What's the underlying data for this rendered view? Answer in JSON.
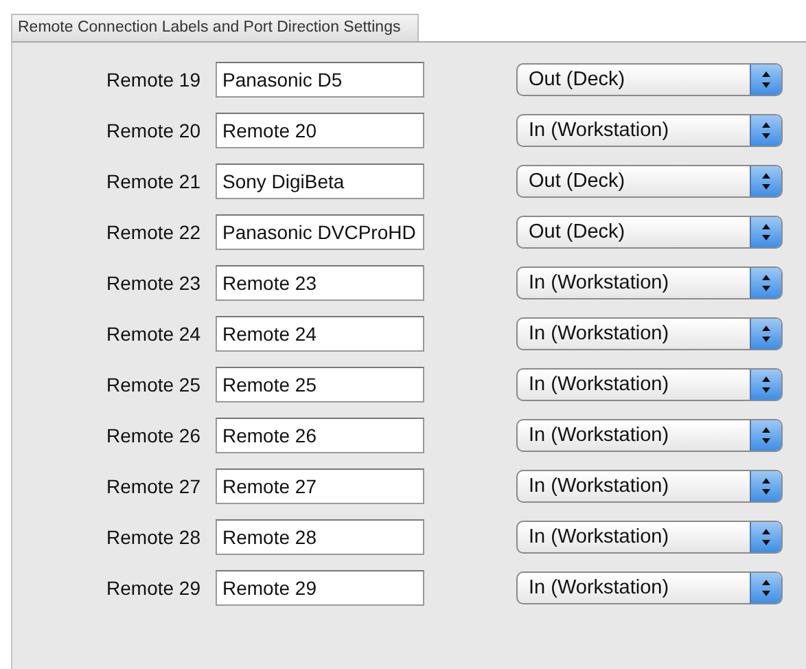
{
  "section_title": "Remote Connection Labels and Port Direction Settings",
  "remotes": [
    {
      "label": "Remote 19",
      "name": "Panasonic D5",
      "direction": "Out (Deck)"
    },
    {
      "label": "Remote 20",
      "name": "Remote 20",
      "direction": "In (Workstation)"
    },
    {
      "label": "Remote 21",
      "name": "Sony DigiBeta",
      "direction": "Out (Deck)"
    },
    {
      "label": "Remote 22",
      "name": "Panasonic DVCProHD",
      "direction": "Out (Deck)"
    },
    {
      "label": "Remote 23",
      "name": "Remote 23",
      "direction": "In (Workstation)"
    },
    {
      "label": "Remote 24",
      "name": "Remote 24",
      "direction": "In (Workstation)"
    },
    {
      "label": "Remote 25",
      "name": "Remote 25",
      "direction": "In (Workstation)"
    },
    {
      "label": "Remote 26",
      "name": "Remote 26",
      "direction": "In (Workstation)"
    },
    {
      "label": "Remote 27",
      "name": "Remote 27",
      "direction": "In (Workstation)"
    },
    {
      "label": "Remote 28",
      "name": "Remote 28",
      "direction": "In (Workstation)"
    },
    {
      "label": "Remote 29",
      "name": "Remote 29",
      "direction": "In (Workstation)"
    }
  ]
}
